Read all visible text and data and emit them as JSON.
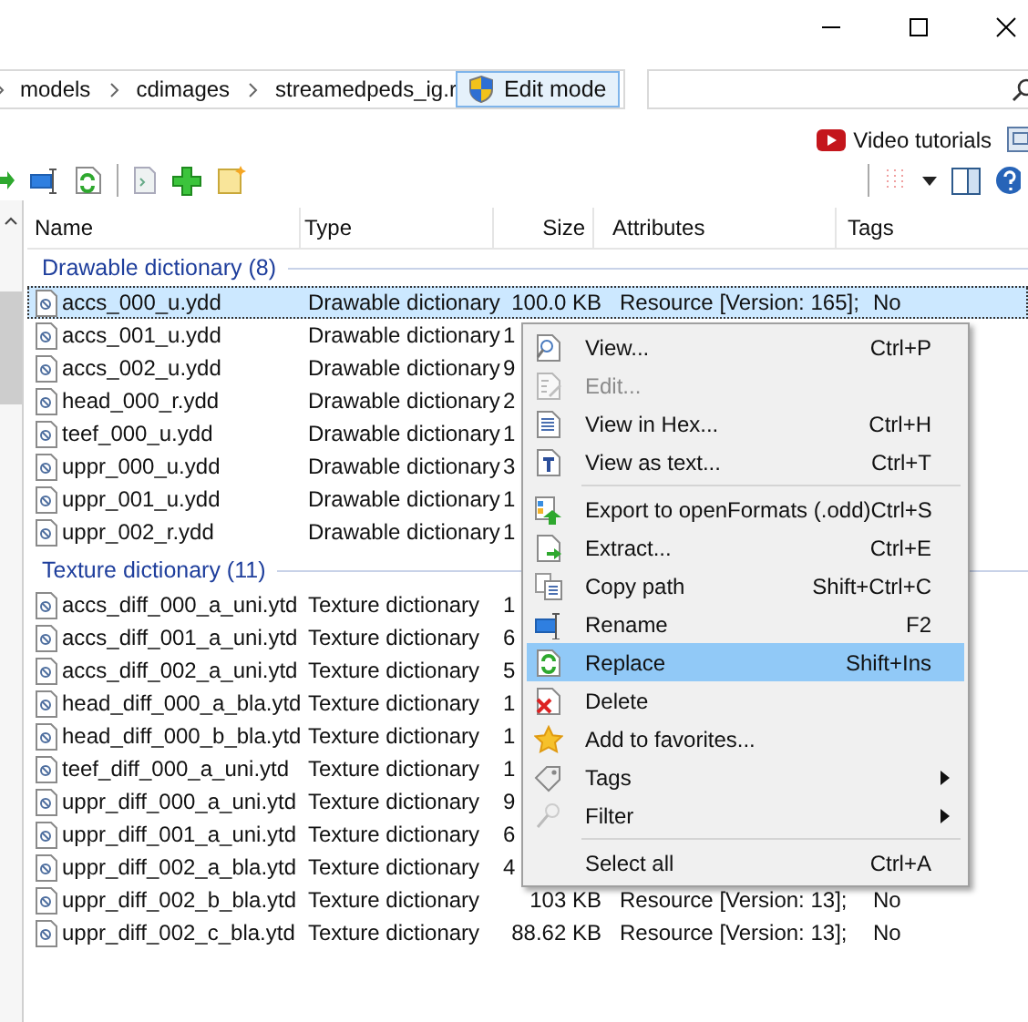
{
  "breadcrumb": [
    "models",
    "cdimages",
    "streamedpeds_ig.r"
  ],
  "edit_mode_button": "Edit mode",
  "video_tutorials": "Video tutorials",
  "columns": [
    "Name",
    "Type",
    "Size",
    "Attributes",
    "Tags"
  ],
  "groups": [
    {
      "title": "Drawable dictionary (8)",
      "rows": [
        {
          "name": "accs_000_u.ydd",
          "type": "Drawable dictionary",
          "size": "100.0 KB",
          "attributes": "Resource [Version: 165];",
          "tags": "No",
          "selected": true
        },
        {
          "name": "accs_001_u.ydd",
          "type": "Drawable dictionary",
          "size": "1",
          "selected": false
        },
        {
          "name": "accs_002_u.ydd",
          "type": "Drawable dictionary",
          "size": "9",
          "selected": false
        },
        {
          "name": "head_000_r.ydd",
          "type": "Drawable dictionary",
          "size": "2",
          "selected": false
        },
        {
          "name": "teef_000_u.ydd",
          "type": "Drawable dictionary",
          "size": "1",
          "selected": false
        },
        {
          "name": "uppr_000_u.ydd",
          "type": "Drawable dictionary",
          "size": "3",
          "selected": false
        },
        {
          "name": "uppr_001_u.ydd",
          "type": "Drawable dictionary",
          "size": "1",
          "selected": false
        },
        {
          "name": "uppr_002_r.ydd",
          "type": "Drawable dictionary",
          "size": "1",
          "selected": false
        }
      ]
    },
    {
      "title": "Texture dictionary (11)",
      "rows": [
        {
          "name": "accs_diff_000_a_uni.ytd",
          "type": "Texture dictionary",
          "size": "1",
          "selected": false
        },
        {
          "name": "accs_diff_001_a_uni.ytd",
          "type": "Texture dictionary",
          "size": "6",
          "selected": false
        },
        {
          "name": "accs_diff_002_a_uni.ytd",
          "type": "Texture dictionary",
          "size": "5",
          "selected": false
        },
        {
          "name": "head_diff_000_a_bla.ytd",
          "type": "Texture dictionary",
          "size": "1",
          "selected": false
        },
        {
          "name": "head_diff_000_b_bla.ytd",
          "type": "Texture dictionary",
          "size": "1",
          "selected": false
        },
        {
          "name": "teef_diff_000_a_uni.ytd",
          "type": "Texture dictionary",
          "size": "1",
          "selected": false
        },
        {
          "name": "uppr_diff_000_a_uni.ytd",
          "type": "Texture dictionary",
          "size": "9",
          "selected": false
        },
        {
          "name": "uppr_diff_001_a_uni.ytd",
          "type": "Texture dictionary",
          "size": "6",
          "selected": false
        },
        {
          "name": "uppr_diff_002_a_bla.ytd",
          "type": "Texture dictionary",
          "size": "4",
          "selected": false
        },
        {
          "name": "uppr_diff_002_b_bla.ytd",
          "type": "Texture dictionary",
          "size": "103 KB",
          "attributes": "Resource [Version: 13];",
          "tags": "No",
          "selected": false
        },
        {
          "name": "uppr_diff_002_c_bla.ytd",
          "type": "Texture dictionary",
          "size": "88.62 KB",
          "attributes": "Resource [Version: 13];",
          "tags": "No",
          "selected": false
        }
      ]
    }
  ],
  "context_menu": {
    "groups": [
      [
        {
          "label": "View...",
          "shortcut": "Ctrl+P",
          "disabled": false,
          "selected": false
        },
        {
          "label": "Edit...",
          "disabled": true,
          "selected": false
        },
        {
          "label": "View in Hex...",
          "shortcut": "Ctrl+H",
          "disabled": false,
          "selected": false
        },
        {
          "label": "View as text...",
          "shortcut": "Ctrl+T",
          "disabled": false,
          "selected": false
        }
      ],
      [
        {
          "label": "Export to openFormats (.odd)",
          "shortcut": "Ctrl+S",
          "disabled": false,
          "selected": false
        },
        {
          "label": "Extract...",
          "shortcut": "Ctrl+E",
          "disabled": false,
          "selected": false
        },
        {
          "label": "Copy path",
          "shortcut": "Shift+Ctrl+C",
          "disabled": false,
          "selected": false
        },
        {
          "label": "Rename",
          "shortcut": "F2",
          "disabled": false,
          "selected": false
        },
        {
          "label": "Replace",
          "shortcut": "Shift+Ins",
          "disabled": false,
          "selected": true
        },
        {
          "label": "Delete",
          "disabled": false,
          "selected": false
        },
        {
          "label": "Add to favorites...",
          "disabled": false,
          "selected": false
        },
        {
          "label": "Tags",
          "submenu": true,
          "disabled": false,
          "selected": false
        },
        {
          "label": "Filter",
          "submenu": true,
          "disabled": false,
          "selected": false
        }
      ],
      [
        {
          "label": "Select all",
          "shortcut": "Ctrl+A",
          "disabled": false,
          "selected": false
        }
      ]
    ]
  }
}
